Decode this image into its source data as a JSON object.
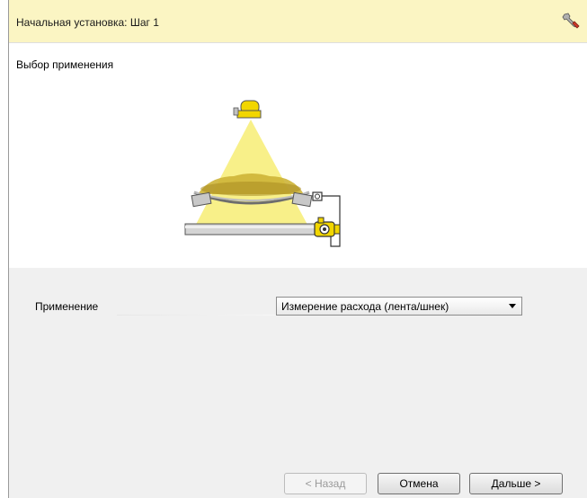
{
  "window": {
    "title": "Начальная установка: Шаг 1"
  },
  "content": {
    "section_title": "Выбор применения"
  },
  "form": {
    "application_label": "Применение",
    "application_value": "Измерение расхода (лента/шнек)"
  },
  "buttons": {
    "back": "< Назад",
    "cancel": "Отмена",
    "next": "Дальше >"
  },
  "colors": {
    "header_bg": "#fbf5c3",
    "panel_bg": "#f0f0f0",
    "accent_yellow": "#f7e800"
  },
  "icons": {
    "header_icon": "wrench-icon"
  }
}
